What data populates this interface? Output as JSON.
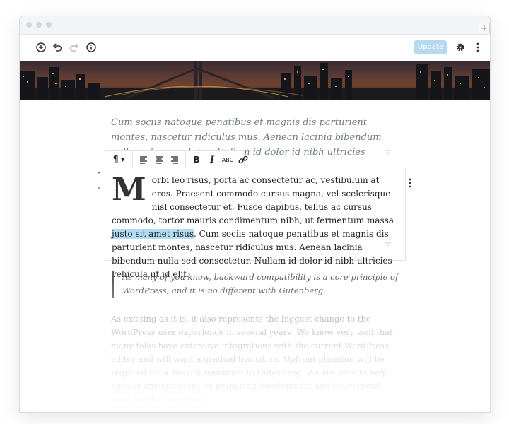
{
  "toolbar": {
    "update_label": "Update",
    "icons": [
      "add-block-icon",
      "undo-icon",
      "redo-icon",
      "info-icon",
      "gear-icon",
      "more-vertical-icon"
    ]
  },
  "content": {
    "intro_paragraph": "Cum sociis natoque penatibus et magnis dis parturient montes, nascetur ridiculus mus. Aenean lacinia bibendum nulla sed consectetur. Nullam id dolor id nibh ultricies vehicula ut id elit.",
    "block_toolbar": {
      "paragraph_symbol": "¶",
      "bold": "B",
      "italic": "I",
      "strikethrough": "ABC"
    },
    "active_block": {
      "dropcap": "M",
      "text_before": "orbi leo risus, porta ac consectetur ac, vestibulum at eros. Praesent commodo cursus magna, vel scelerisque nisl consectetur et. Fusce dapibus, tellus ac cursus commodo, tortor mauris condimentum nibh, ut fermentum massa ",
      "highlighted": "justo sit amet risus",
      "text_after": ". Cum sociis natoque penatibus et magnis dis parturient montes, nascetur ridiculus mus. Aenean lacinia bibendum nulla sed consectetur. Nullam id dolor id nibh ultricies vehicula ut id elit."
    },
    "quote": "As many of you know, backward compatibility is a core principle of WordPress, and it is no different with Gutenberg.",
    "faded_paragraph": "As exciting as it is, it also represents the biggest change to the WordPress user experience in several years. We know very well that many folks have extensive integrations with the current WordPress editor and will want a gradual transition. Upfront planning will be required for a smooth transition to Gutenberg. We are here to help answer any questions on preparing development and educational tools for the transition."
  },
  "colors": {
    "accent": "#b7d9ee",
    "highlight": "#b3dcf5",
    "text": "#222222",
    "muted": "#6f7a84"
  }
}
